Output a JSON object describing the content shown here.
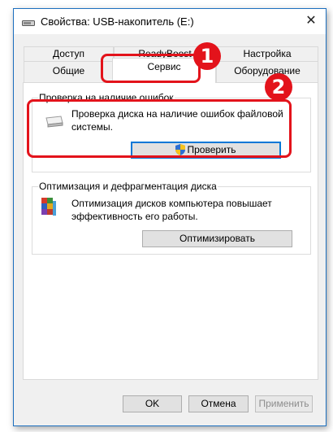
{
  "window": {
    "title": "Свойства: USB-накопитель (E:)",
    "close_glyph": "✕"
  },
  "tabs": {
    "row1": [
      "Доступ",
      "ReadyBoost",
      "Настройка"
    ],
    "row2": [
      "Общие",
      "Сервис",
      "Оборудование"
    ],
    "active": "Сервис"
  },
  "error_check": {
    "group_title": "Проверка на наличие ошибок",
    "description": "Проверка диска на наличие ошибок файловой системы.",
    "button_label": "Проверить",
    "icon": "usb-drive-icon"
  },
  "optimize": {
    "group_title": "Оптимизация и дефрагментация диска",
    "description": "Оптимизация дисков компьютера повышает эффективность его работы.",
    "button_label": "Оптимизировать",
    "icon": "defrag-icon"
  },
  "footer": {
    "ok_label": "OK",
    "cancel_label": "Отмена",
    "apply_label": "Применить"
  },
  "annotations": [
    {
      "label": "1",
      "target": "tab-service"
    },
    {
      "label": "2",
      "target": "error-check-group"
    }
  ],
  "colors": {
    "annotation_red": "#e3131b",
    "window_border": "#1c6fbf",
    "focus_blue": "#0078d7"
  }
}
